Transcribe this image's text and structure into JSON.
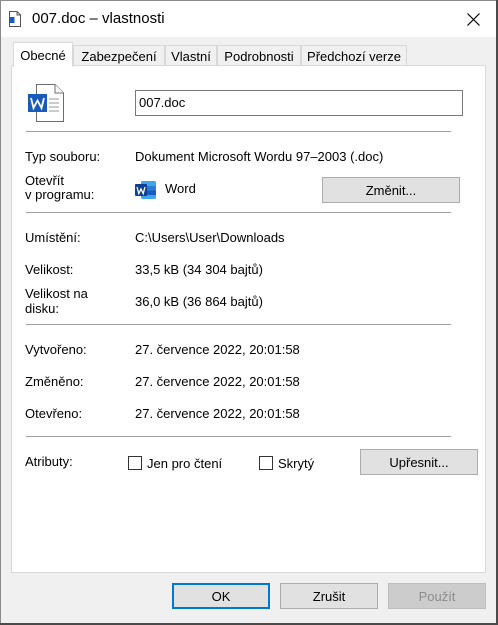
{
  "window": {
    "title": "007.doc – vlastnosti"
  },
  "tabs": [
    "Obecné",
    "Zabezpečení",
    "Vlastní",
    "Podrobnosti",
    "Předchozí verze"
  ],
  "file_name": "007.doc",
  "rows": {
    "type_label": "Typ souboru:",
    "type_value": "Dokument Microsoft Wordu 97–2003 (.doc)",
    "open_label_1": "Otevřít",
    "open_label_2": "v programu:",
    "open_app": "Word",
    "change_button": "Změnit...",
    "location_label": "Umístění:",
    "location_value": "C:\\Users\\User\\Downloads",
    "size_label": "Velikost:",
    "size_value": "33,5 kB (34 304 bajtů)",
    "disk_label_1": "Velikost na",
    "disk_label_2": "disku:",
    "disk_value": "36,0 kB (36 864 bajtů)",
    "created_label": "Vytvořeno:",
    "created_value": "27. července 2022, 20:01:58",
    "modified_label": "Změněno:",
    "modified_value": "27. července 2022, 20:01:58",
    "opened_label": "Otevřeno:",
    "opened_value": "27. července 2022, 20:01:58",
    "attrs_label": "Atributy:",
    "readonly_label": "Jen pro čtení",
    "hidden_label": "Skrytý",
    "advanced_button": "Upřesnit..."
  },
  "footer": {
    "ok": "OK",
    "cancel": "Zrušit",
    "apply": "Použít"
  },
  "colors": {
    "accent": "#0078d7",
    "word_blue": "#185abd"
  }
}
